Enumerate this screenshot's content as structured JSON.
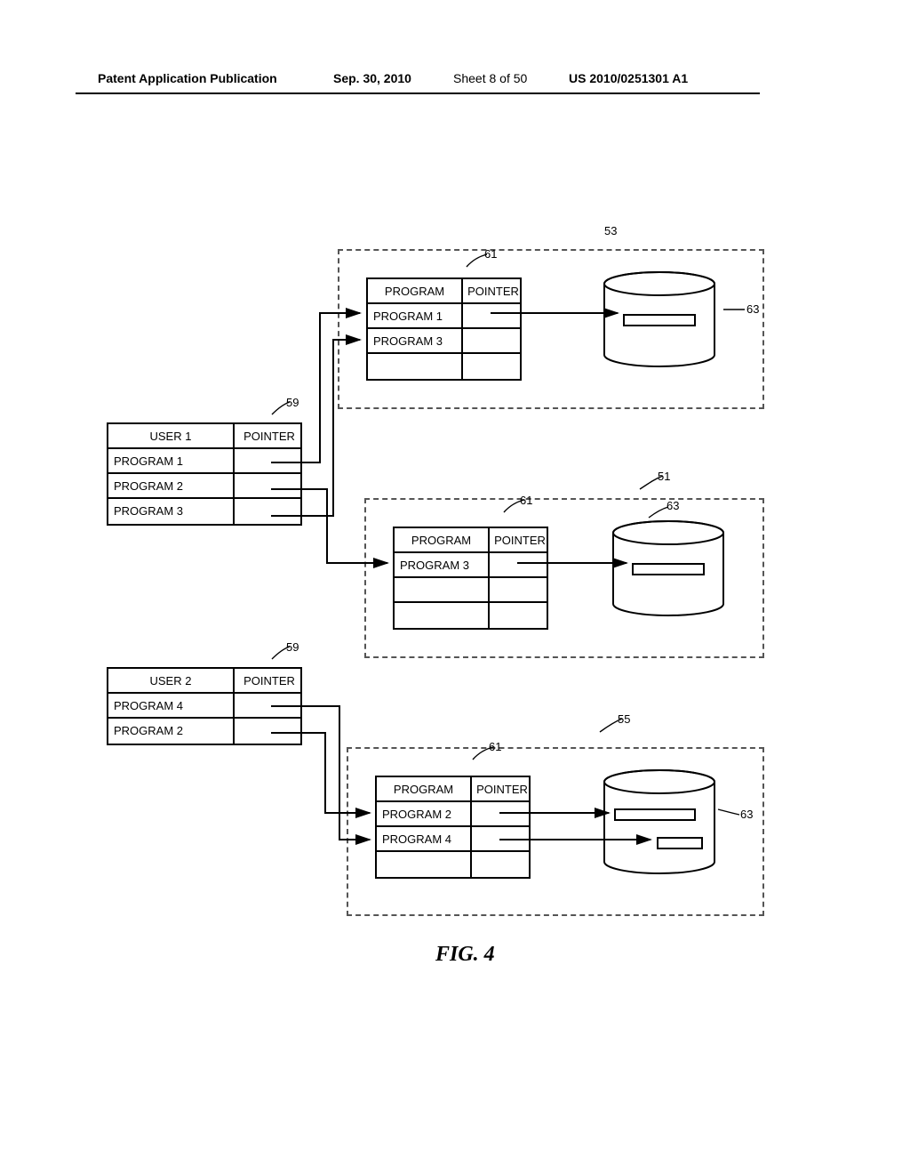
{
  "header": {
    "publication": "Patent Application Publication",
    "date": "Sep. 30, 2010",
    "sheet": "Sheet 8 of 50",
    "pubno": "US 2010/0251301 A1"
  },
  "labels": {
    "user": "USER",
    "pointer": "POINTER",
    "program": "PROGRAM"
  },
  "user_tables": [
    {
      "user_num": "1",
      "programs": [
        "PROGRAM 1",
        "PROGRAM 2",
        "PROGRAM 3"
      ]
    },
    {
      "user_num": "2",
      "programs": [
        "PROGRAM 4",
        "PROGRAM 2"
      ]
    }
  ],
  "servers": [
    {
      "programs": [
        "PROGRAM 1",
        "PROGRAM 3"
      ]
    },
    {
      "programs": [
        "PROGRAM 3"
      ]
    },
    {
      "programs": [
        "PROGRAM 2",
        "PROGRAM 4"
      ]
    }
  ],
  "refs": {
    "r53": "53",
    "r51": "51",
    "r55": "55",
    "r59": "59",
    "r61": "61",
    "r63": "63"
  },
  "figure_label": "FIG. 4"
}
